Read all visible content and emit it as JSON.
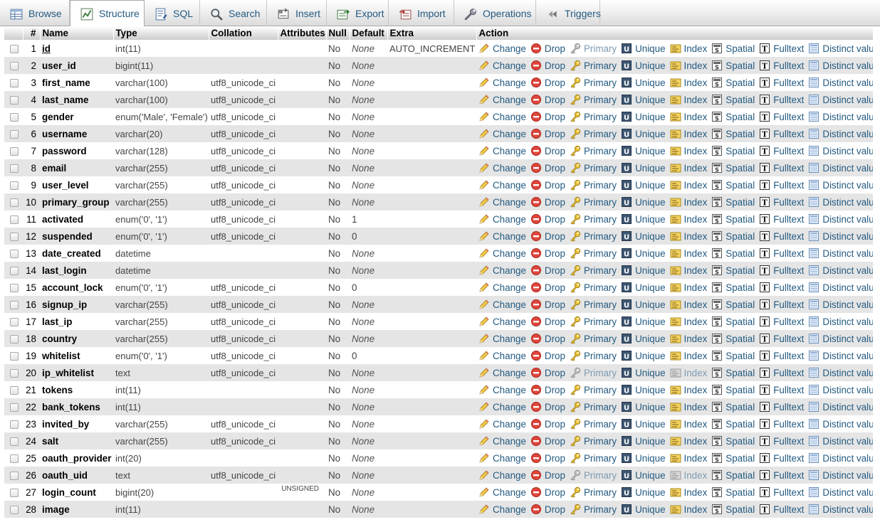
{
  "tabs": [
    {
      "label": "Browse",
      "icon": "browse-icon",
      "active": false
    },
    {
      "label": "Structure",
      "icon": "structure-icon",
      "active": true
    },
    {
      "label": "SQL",
      "icon": "sql-icon",
      "active": false
    },
    {
      "label": "Search",
      "icon": "search-icon",
      "active": false
    },
    {
      "label": "Insert",
      "icon": "insert-icon",
      "active": false
    },
    {
      "label": "Export",
      "icon": "export-icon",
      "active": false
    },
    {
      "label": "Import",
      "icon": "import-icon",
      "active": false
    },
    {
      "label": "Operations",
      "icon": "wrench-icon",
      "active": false
    },
    {
      "label": "Triggers",
      "icon": "triggers-icon",
      "active": false
    }
  ],
  "columns": [
    "#",
    "Name",
    "Type",
    "Collation",
    "Attributes",
    "Null",
    "Default",
    "Extra",
    "Action"
  ],
  "actions": {
    "change": "Change",
    "drop": "Drop",
    "primary": "Primary",
    "unique": "Unique",
    "index": "Index",
    "spatial": "Spatial",
    "fulltext": "Fulltext",
    "distinct": "Distinct values"
  },
  "colors": {
    "link": "#235a81",
    "row_alt": "#e5e5e5"
  },
  "rows": [
    {
      "n": "1",
      "name": "id",
      "type": "int(11)",
      "collation": "",
      "attributes": "",
      "null": "No",
      "default": "None",
      "extra": "AUTO_INCREMENT",
      "primary_disabled": true,
      "index_disabled": false
    },
    {
      "n": "2",
      "name": "user_id",
      "type": "bigint(11)",
      "collation": "",
      "attributes": "",
      "null": "No",
      "default": "None",
      "extra": "",
      "primary_disabled": false,
      "index_disabled": false
    },
    {
      "n": "3",
      "name": "first_name",
      "type": "varchar(100)",
      "collation": "utf8_unicode_ci",
      "attributes": "",
      "null": "No",
      "default": "None",
      "extra": "",
      "primary_disabled": false,
      "index_disabled": false
    },
    {
      "n": "4",
      "name": "last_name",
      "type": "varchar(100)",
      "collation": "utf8_unicode_ci",
      "attributes": "",
      "null": "No",
      "default": "None",
      "extra": "",
      "primary_disabled": false,
      "index_disabled": false
    },
    {
      "n": "5",
      "name": "gender",
      "type": "enum('Male', 'Female')",
      "collation": "utf8_unicode_ci",
      "attributes": "",
      "null": "No",
      "default": "None",
      "extra": "",
      "primary_disabled": false,
      "index_disabled": false
    },
    {
      "n": "6",
      "name": "username",
      "type": "varchar(20)",
      "collation": "utf8_unicode_ci",
      "attributes": "",
      "null": "No",
      "default": "None",
      "extra": "",
      "primary_disabled": false,
      "index_disabled": false
    },
    {
      "n": "7",
      "name": "password",
      "type": "varchar(128)",
      "collation": "utf8_unicode_ci",
      "attributes": "",
      "null": "No",
      "default": "None",
      "extra": "",
      "primary_disabled": false,
      "index_disabled": false
    },
    {
      "n": "8",
      "name": "email",
      "type": "varchar(255)",
      "collation": "utf8_unicode_ci",
      "attributes": "",
      "null": "No",
      "default": "None",
      "extra": "",
      "primary_disabled": false,
      "index_disabled": false
    },
    {
      "n": "9",
      "name": "user_level",
      "type": "varchar(255)",
      "collation": "utf8_unicode_ci",
      "attributes": "",
      "null": "No",
      "default": "None",
      "extra": "",
      "primary_disabled": false,
      "index_disabled": false
    },
    {
      "n": "10",
      "name": "primary_group",
      "type": "varchar(255)",
      "collation": "utf8_unicode_ci",
      "attributes": "",
      "null": "No",
      "default": "None",
      "extra": "",
      "primary_disabled": false,
      "index_disabled": false
    },
    {
      "n": "11",
      "name": "activated",
      "type": "enum('0', '1')",
      "collation": "utf8_unicode_ci",
      "attributes": "",
      "null": "No",
      "default": "1",
      "extra": "",
      "primary_disabled": false,
      "index_disabled": false
    },
    {
      "n": "12",
      "name": "suspended",
      "type": "enum('0', '1')",
      "collation": "utf8_unicode_ci",
      "attributes": "",
      "null": "No",
      "default": "0",
      "extra": "",
      "primary_disabled": false,
      "index_disabled": false
    },
    {
      "n": "13",
      "name": "date_created",
      "type": "datetime",
      "collation": "",
      "attributes": "",
      "null": "No",
      "default": "None",
      "extra": "",
      "primary_disabled": false,
      "index_disabled": false
    },
    {
      "n": "14",
      "name": "last_login",
      "type": "datetime",
      "collation": "",
      "attributes": "",
      "null": "No",
      "default": "None",
      "extra": "",
      "primary_disabled": false,
      "index_disabled": false
    },
    {
      "n": "15",
      "name": "account_lock",
      "type": "enum('0', '1')",
      "collation": "utf8_unicode_ci",
      "attributes": "",
      "null": "No",
      "default": "0",
      "extra": "",
      "primary_disabled": false,
      "index_disabled": false
    },
    {
      "n": "16",
      "name": "signup_ip",
      "type": "varchar(255)",
      "collation": "utf8_unicode_ci",
      "attributes": "",
      "null": "No",
      "default": "None",
      "extra": "",
      "primary_disabled": false,
      "index_disabled": false
    },
    {
      "n": "17",
      "name": "last_ip",
      "type": "varchar(255)",
      "collation": "utf8_unicode_ci",
      "attributes": "",
      "null": "No",
      "default": "None",
      "extra": "",
      "primary_disabled": false,
      "index_disabled": false
    },
    {
      "n": "18",
      "name": "country",
      "type": "varchar(255)",
      "collation": "utf8_unicode_ci",
      "attributes": "",
      "null": "No",
      "default": "None",
      "extra": "",
      "primary_disabled": false,
      "index_disabled": false
    },
    {
      "n": "19",
      "name": "whitelist",
      "type": "enum('0', '1')",
      "collation": "utf8_unicode_ci",
      "attributes": "",
      "null": "No",
      "default": "0",
      "extra": "",
      "primary_disabled": false,
      "index_disabled": false
    },
    {
      "n": "20",
      "name": "ip_whitelist",
      "type": "text",
      "collation": "utf8_unicode_ci",
      "attributes": "",
      "null": "No",
      "default": "None",
      "extra": "",
      "primary_disabled": true,
      "index_disabled": true
    },
    {
      "n": "21",
      "name": "tokens",
      "type": "int(11)",
      "collation": "",
      "attributes": "",
      "null": "No",
      "default": "None",
      "extra": "",
      "primary_disabled": false,
      "index_disabled": false
    },
    {
      "n": "22",
      "name": "bank_tokens",
      "type": "int(11)",
      "collation": "",
      "attributes": "",
      "null": "No",
      "default": "None",
      "extra": "",
      "primary_disabled": false,
      "index_disabled": false
    },
    {
      "n": "23",
      "name": "invited_by",
      "type": "varchar(255)",
      "collation": "utf8_unicode_ci",
      "attributes": "",
      "null": "No",
      "default": "None",
      "extra": "",
      "primary_disabled": false,
      "index_disabled": false
    },
    {
      "n": "24",
      "name": "salt",
      "type": "varchar(255)",
      "collation": "utf8_unicode_ci",
      "attributes": "",
      "null": "No",
      "default": "None",
      "extra": "",
      "primary_disabled": false,
      "index_disabled": false
    },
    {
      "n": "25",
      "name": "oauth_provider",
      "type": "int(20)",
      "collation": "",
      "attributes": "",
      "null": "No",
      "default": "None",
      "extra": "",
      "primary_disabled": false,
      "index_disabled": false
    },
    {
      "n": "26",
      "name": "oauth_uid",
      "type": "text",
      "collation": "utf8_unicode_ci",
      "attributes": "",
      "null": "No",
      "default": "None",
      "extra": "",
      "primary_disabled": true,
      "index_disabled": true
    },
    {
      "n": "27",
      "name": "login_count",
      "type": "bigint(20)",
      "collation": "",
      "attributes": "UNSIGNED",
      "null": "No",
      "default": "None",
      "extra": "",
      "primary_disabled": false,
      "index_disabled": false
    },
    {
      "n": "28",
      "name": "image",
      "type": "int(11)",
      "collation": "",
      "attributes": "",
      "null": "No",
      "default": "None",
      "extra": "",
      "primary_disabled": false,
      "index_disabled": false
    }
  ]
}
